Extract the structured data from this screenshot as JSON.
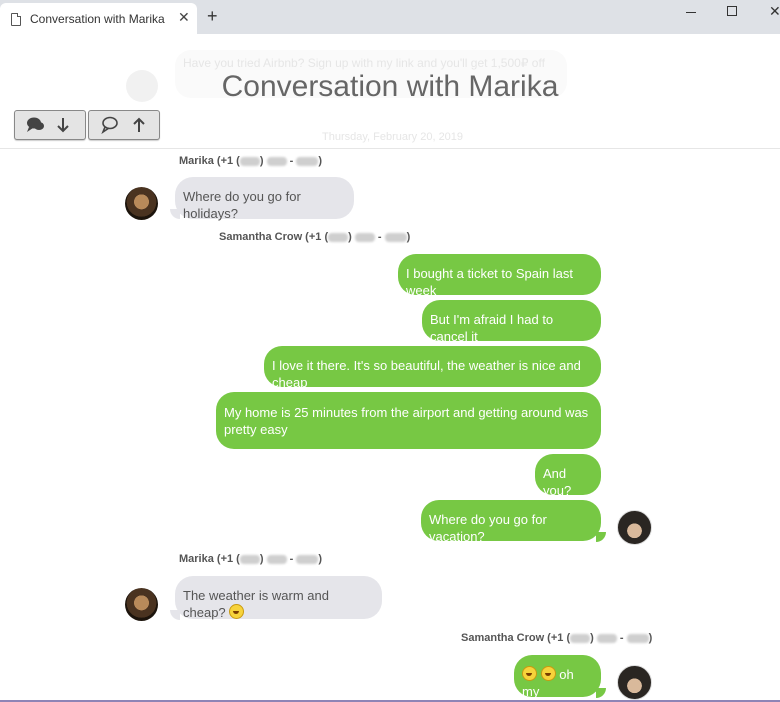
{
  "browser": {
    "tab_title": "Conversation with Marika",
    "close_glyph": "✕",
    "new_tab_glyph": "+",
    "window_close_glyph": "✕"
  },
  "ghost": {
    "text1": "Have you tried Airbnb? Sign up with my link and you'll get 1,500₽ off",
    "date": "Thursday, February 20, 2019"
  },
  "page": {
    "title": "Conversation with Marika"
  },
  "nav": {
    "down_icon": "chat-bubbles-arrow-down-icon",
    "up_icon": "chat-bubbles-arrow-up-icon"
  },
  "senders": {
    "marika_prefix": "Marika (+1 (",
    "samantha_prefix": "Samantha Crow (+1 (",
    "mid1": ") ",
    "dash": " - ",
    "close": ")"
  },
  "messages": [
    {
      "from": "Marika",
      "text": "Where do you go for holidays?"
    },
    {
      "from": "Samantha Crow",
      "text": "I bought a ticket to Spain last week"
    },
    {
      "from": "Samantha Crow",
      "text": "But I'm afraid I had to cancel it"
    },
    {
      "from": "Samantha Crow",
      "text": "I love it there. It's so beautiful, the weather is nice and cheap"
    },
    {
      "from": "Samantha Crow",
      "text": "My home is 25 minutes from the airport and getting around was pretty easy"
    },
    {
      "from": "Samantha Crow",
      "text": "And you?"
    },
    {
      "from": "Samantha Crow",
      "text": "Where do you go for vacation?"
    },
    {
      "from": "Marika",
      "text": "The weather is warm and cheap?"
    },
    {
      "from": "Samantha Crow",
      "text": "oh my"
    }
  ],
  "colors": {
    "outgoing": "#77c844",
    "incoming": "#e5e5ea"
  }
}
